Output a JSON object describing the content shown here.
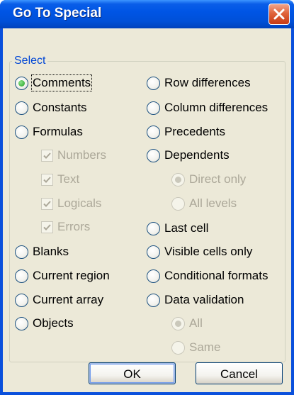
{
  "window": {
    "title": "Go To Special"
  },
  "group": {
    "label": "Select"
  },
  "left_options": [
    {
      "label": "Comments",
      "selected": true,
      "enabled": true
    },
    {
      "label": "Constants",
      "selected": false,
      "enabled": true
    },
    {
      "label": "Formulas",
      "selected": false,
      "enabled": true
    },
    {
      "label": "Blanks",
      "selected": false,
      "enabled": true
    },
    {
      "label": "Current region",
      "selected": false,
      "enabled": true
    },
    {
      "label": "Current array",
      "selected": false,
      "enabled": true
    },
    {
      "label": "Objects",
      "selected": false,
      "enabled": true
    }
  ],
  "formula_checks": [
    {
      "label": "Numbers",
      "checked": true,
      "enabled": false
    },
    {
      "label": "Text",
      "checked": true,
      "enabled": false
    },
    {
      "label": "Logicals",
      "checked": true,
      "enabled": false
    },
    {
      "label": "Errors",
      "checked": true,
      "enabled": false
    }
  ],
  "right_options": [
    {
      "label": "Row differences",
      "selected": false,
      "enabled": true
    },
    {
      "label": "Column differences",
      "selected": false,
      "enabled": true
    },
    {
      "label": "Precedents",
      "selected": false,
      "enabled": true
    },
    {
      "label": "Dependents",
      "selected": false,
      "enabled": true
    },
    {
      "label": "Last cell",
      "selected": false,
      "enabled": true
    },
    {
      "label": "Visible cells only",
      "selected": false,
      "enabled": true
    },
    {
      "label": "Conditional formats",
      "selected": false,
      "enabled": true
    },
    {
      "label": "Data validation",
      "selected": false,
      "enabled": true
    }
  ],
  "dependents_sub": [
    {
      "label": "Direct only",
      "selected": true,
      "enabled": false
    },
    {
      "label": "All levels",
      "selected": false,
      "enabled": false
    }
  ],
  "validation_sub": [
    {
      "label": "All",
      "selected": true,
      "enabled": false
    },
    {
      "label": "Same",
      "selected": false,
      "enabled": false
    }
  ],
  "buttons": {
    "ok": "OK",
    "cancel": "Cancel"
  },
  "colors": {
    "title_bar": "#0055e5",
    "face": "#ece9d8",
    "group_label": "#0046d5",
    "radio_dot": "#21a121"
  },
  "icons": {
    "close": "close-icon",
    "check": "check-icon"
  }
}
